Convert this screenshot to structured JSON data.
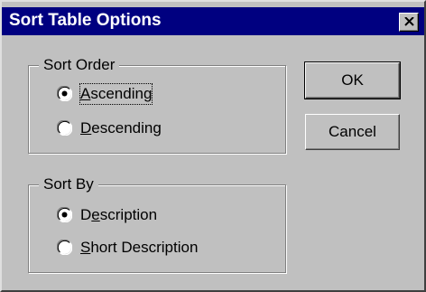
{
  "window": {
    "title": "Sort Table Options",
    "close_glyph": "close-icon"
  },
  "sort_order": {
    "label": "Sort Order",
    "options": [
      {
        "label": "Ascending",
        "underline": "A",
        "rest": "scending",
        "selected": true
      },
      {
        "label": "Descending",
        "underline": "D",
        "rest": "escending",
        "selected": false
      }
    ]
  },
  "sort_by": {
    "label": "Sort By",
    "options": [
      {
        "label": "Description",
        "prefix": "D",
        "underline": "e",
        "rest": "scription",
        "selected": true
      },
      {
        "label": "Short Description",
        "underline": "S",
        "rest": "hort Description",
        "selected": false
      }
    ]
  },
  "buttons": {
    "ok": "OK",
    "cancel": "Cancel"
  },
  "colors": {
    "titlebar": "#000080",
    "face": "#c0c0c0"
  }
}
